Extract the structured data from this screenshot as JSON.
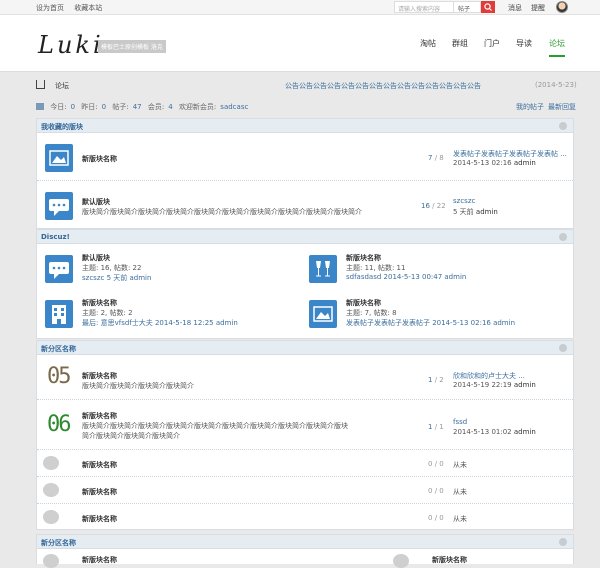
{
  "topbar": {
    "set_home": "设为首页",
    "bookmark": "收藏本站",
    "search_placeholder": "请输入搜索内容",
    "search_type": "帖子",
    "messages": "消息",
    "reminders": "提醒"
  },
  "header": {
    "logo": "Luki",
    "tagline": "模板巴士原创模板 洛克",
    "nav": [
      "淘帖",
      "群组",
      "门户",
      "导读",
      "论坛"
    ],
    "nav_active": "论坛"
  },
  "crumb": {
    "current": "论坛",
    "notice": "公告公告公告公告公告公告公告公告公告公告公告公告公告公告",
    "notice_date": "(2014-5-23)"
  },
  "stats": {
    "today_label": "今日:",
    "today": "0",
    "yesterday_label": "昨日:",
    "yesterday": "0",
    "posts_label": "帖子:",
    "posts": "47",
    "members_label": "会员:",
    "members": "4",
    "welcome": "欢迎新会员:",
    "new_member": "sadcasc",
    "my_posts": "我的帖子",
    "latest_replies": "最新回复"
  },
  "sections": [
    {
      "title": "我收藏的版块",
      "rows": [
        {
          "name": "新版块名称",
          "desc": "",
          "threads": "7",
          "posts": "8",
          "last_title": "发表帖子发表帖子发表帖子发表帖 ...",
          "last_time": "2014-5-13 02:16",
          "last_user": "admin"
        },
        {
          "name": "默认版块",
          "desc": "版块简介版块简介版块简介版块简介版块简介版块简介版块简介版块简介版块简介版块简介",
          "threads": "16",
          "posts": "22",
          "last_title": "szcszc",
          "last_time": "5 天前",
          "last_user": "admin"
        }
      ]
    },
    {
      "title": "Discuz!",
      "grid": [
        {
          "name": "默认版块",
          "stats": "主题: 16, 帖数: 22",
          "last": "szcszc 5 天前 admin"
        },
        {
          "name": "新版块名称",
          "stats": "主题: 11, 帖数: 11",
          "last": "sdfasdasd 2014-5-13 00:47 admin"
        },
        {
          "name": "新版块名称",
          "stats": "主题: 2, 帖数: 2",
          "last": "最后: 意思vfsdf士大夫 2014-5-18 12:25 admin"
        },
        {
          "name": "新版块名称",
          "stats": "主题: 7, 帖数: 8",
          "last": "发表帖子发表帖子发表帖子 2014-5-13 02:16 admin"
        }
      ]
    },
    {
      "title": "新分区名称",
      "rows": [
        {
          "num": "05",
          "name": "新版块名称",
          "desc": "版块简介版块简介版块简介版块简介",
          "threads": "1",
          "posts": "2",
          "last_title": "欣和欣和的卢士大夫 ...",
          "last_time": "2014-5-19 22:19",
          "last_user": "admin"
        },
        {
          "num": "06",
          "name": "新版块名称",
          "desc": "版块简介版块简介版块简介版块简介版块简介版块简介版块简介版块简介版块简介版块简介版块简介版块简介版块简介",
          "threads": "1",
          "posts": "1",
          "last_title": "fssd",
          "last_time": "2014-5-13 01:02",
          "last_user": "admin"
        },
        {
          "name": "新版块名称",
          "threads": "0",
          "posts": "0",
          "last_title": "从未"
        },
        {
          "name": "新版块名称",
          "threads": "0",
          "posts": "0",
          "last_title": "从未"
        },
        {
          "name": "新版块名称",
          "threads": "0",
          "posts": "0",
          "last_title": "从未"
        }
      ]
    },
    {
      "title": "新分区名称",
      "grid": [
        {
          "name": "新版块名称"
        },
        {
          "name": "新版块名称"
        }
      ]
    }
  ],
  "colors": {
    "accent": "#2a9d2a",
    "link": "#3a6e9d",
    "search_btn": "#e03c3c",
    "icon_blue": "#3a86c8"
  }
}
